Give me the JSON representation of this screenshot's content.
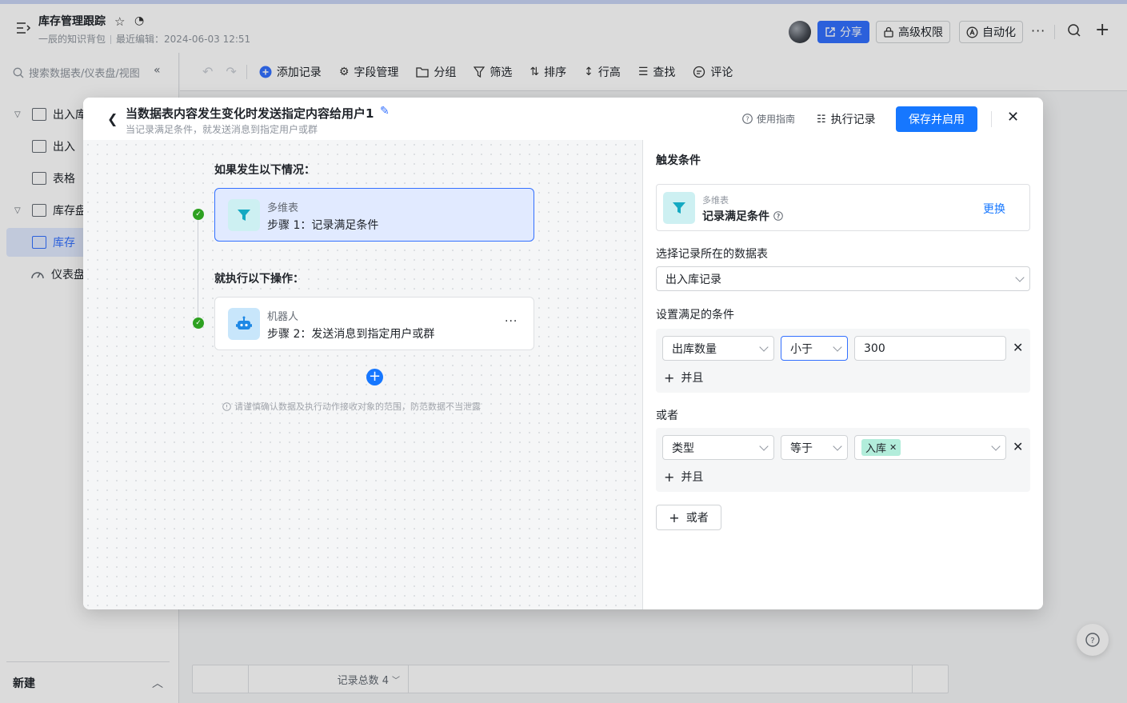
{
  "app": {
    "doc_title": "库存管理跟踪",
    "owner": "一辰的知识背包",
    "last_edited": "最近编辑：2024-06-03 12:51",
    "share_label": "分享",
    "permission_label": "高级权限",
    "automation_label": "自动化",
    "more_label": "···",
    "accent_color": "#3370ff"
  },
  "sidebar": {
    "search_placeholder": "搜索数据表/仪表盘/视图",
    "items": [
      {
        "label": "出入库",
        "type": "table-group"
      },
      {
        "label": "出入",
        "type": "form"
      },
      {
        "label": "表格",
        "type": "grid"
      },
      {
        "label": "库存盘",
        "type": "table-group"
      },
      {
        "label": "库存",
        "type": "grid",
        "active": true
      },
      {
        "label": "仪表盘",
        "type": "dashboard"
      }
    ],
    "new_label": "新建"
  },
  "toolbar": {
    "add_record": "添加记录",
    "field_manage": "字段管理",
    "group": "分组",
    "filter": "筛选",
    "sort": "排序",
    "row_height": "行高",
    "find": "查找",
    "comment": "评论"
  },
  "footer": {
    "record_count": "记录总数 4"
  },
  "modal": {
    "title": "当数据表内容发生变化时发送指定内容给用户1",
    "subtitle": "当记录满足条件，就发送消息到指定用户或群",
    "guide_label": "使用指南",
    "log_label": "执行记录",
    "save_label": "保存并启用",
    "flow": {
      "if_heading": "如果发生以下情况：",
      "then_heading": "就执行以下操作：",
      "step1": {
        "type": "多维表",
        "name": "步骤 1：记录满足条件"
      },
      "step2": {
        "type": "机器人",
        "name": "步骤 2：发送消息到指定用户或群"
      },
      "note": "请谨慎确认数据及执行动作接收对象的范围，防范数据不当泄露"
    },
    "panel": {
      "heading": "触发条件",
      "trigger_type": "多维表",
      "trigger_name": "记录满足条件",
      "change_label": "更换",
      "table_label": "选择记录所在的数据表",
      "table_value": "出入库记录",
      "condition_label": "设置满足的条件",
      "cond1": {
        "field": "出库数量",
        "operator": "小于",
        "value": "300"
      },
      "and_label": "并且",
      "or_heading": "或者",
      "cond2": {
        "field": "类型",
        "operator": "等于",
        "tag": "入库"
      },
      "or_button": "或者"
    }
  }
}
